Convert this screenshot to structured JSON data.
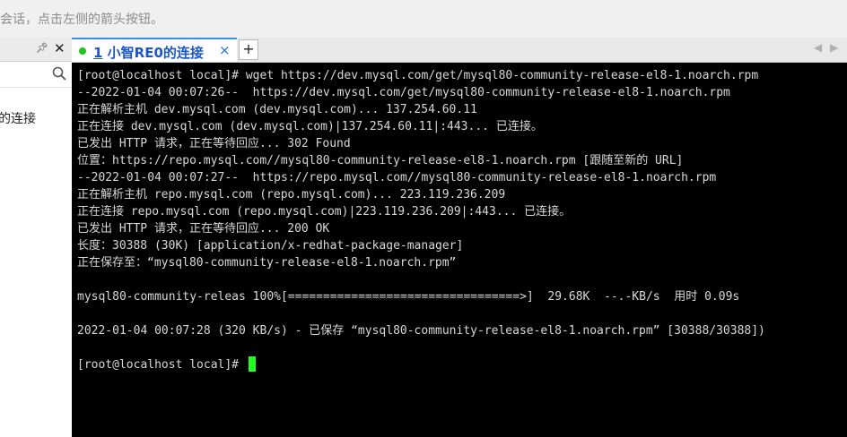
{
  "hint_bar": {
    "text": "会话，点击左侧的箭头按钮。"
  },
  "left_pane": {
    "pin_icon": "pin-icon",
    "close_icon": "close-icon",
    "search_icon": "search-icon",
    "session_item": "的连接"
  },
  "tabs": {
    "active": {
      "number": "1",
      "label": "小智RE0的连接",
      "close": "×"
    },
    "add_label": "+",
    "nav_left": "◀",
    "nav_right": "▶"
  },
  "terminal": {
    "lines": [
      "[root@localhost local]# wget https://dev.mysql.com/get/mysql80-community-release-el8-1.noarch.rpm",
      "--2022-01-04 00:07:26--  https://dev.mysql.com/get/mysql80-community-release-el8-1.noarch.rpm",
      "正在解析主机 dev.mysql.com (dev.mysql.com)... 137.254.60.11",
      "正在连接 dev.mysql.com (dev.mysql.com)|137.254.60.11|:443... 已连接。",
      "已发出 HTTP 请求，正在等待回应... 302 Found",
      "位置：https://repo.mysql.com//mysql80-community-release-el8-1.noarch.rpm [跟随至新的 URL]",
      "--2022-01-04 00:07:27--  https://repo.mysql.com//mysql80-community-release-el8-1.noarch.rpm",
      "正在解析主机 repo.mysql.com (repo.mysql.com)... 223.119.236.209",
      "正在连接 repo.mysql.com (repo.mysql.com)|223.119.236.209|:443... 已连接。",
      "已发出 HTTP 请求，正在等待回应... 200 OK",
      "长度：30388 (30K) [application/x-redhat-package-manager]",
      "正在保存至：“mysql80-community-release-el8-1.noarch.rpm”",
      "",
      "mysql80-community-releas 100%[=================================>]  29.68K  --.-KB/s  用时 0.09s",
      "",
      "2022-01-04 00:07:28 (320 KB/s) - 已保存 “mysql80-community-release-el8-1.noarch.rpm” [30388/30388])",
      "",
      "[root@localhost local]# "
    ],
    "cursor_color": "#22ff22"
  }
}
